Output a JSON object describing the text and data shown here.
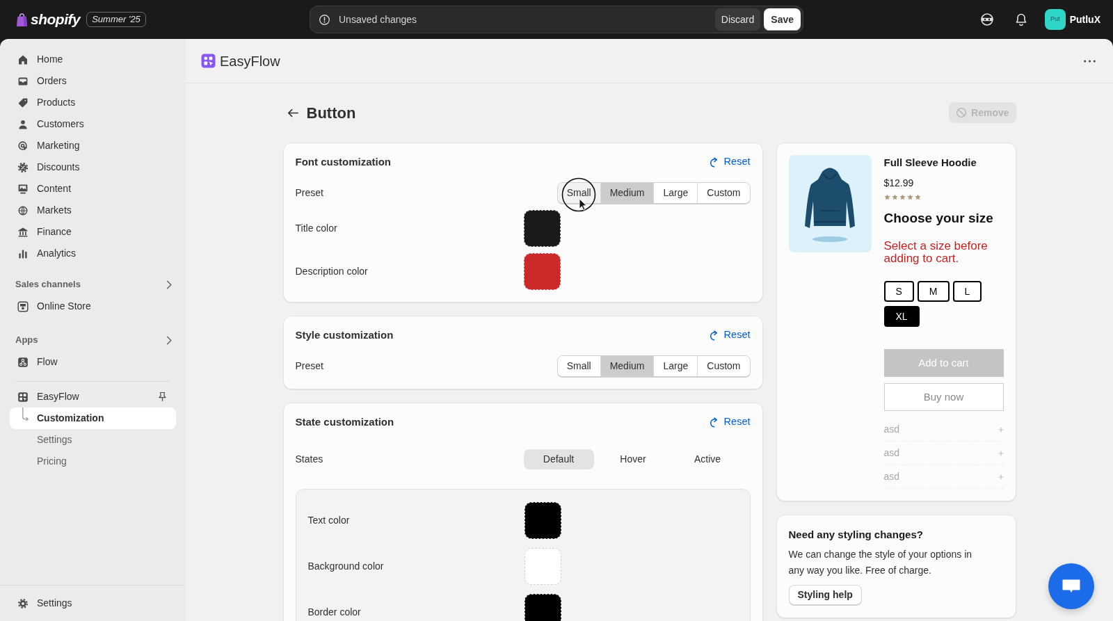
{
  "top_bar": {
    "logo": "shopify",
    "badge": "Summer '25",
    "save_bar": {
      "message": "Unsaved changes",
      "buttons": [
        {
          "label": "Discard",
          "kind": "secondary"
        },
        {
          "label": "Save",
          "kind": "primary"
        }
      ]
    },
    "account": {
      "initials": "Put",
      "name": "PutluX"
    }
  },
  "sidebar": {
    "items": [
      {
        "label": "Home",
        "selected": false
      },
      {
        "label": "Orders",
        "selected": false
      },
      {
        "label": "Products",
        "selected": false
      },
      {
        "label": "Customers",
        "selected": false
      },
      {
        "label": "Marketing",
        "selected": false
      },
      {
        "label": "Discounts",
        "selected": false
      },
      {
        "label": "Content",
        "selected": false
      },
      {
        "label": "Markets",
        "selected": false
      },
      {
        "label": "Finance",
        "selected": false
      },
      {
        "label": "Analytics",
        "selected": false
      }
    ],
    "sections": [
      {
        "title": "Sales channels",
        "items": [
          {
            "label": "Online Store",
            "selected": false
          }
        ]
      },
      {
        "title": "Apps",
        "items": [
          {
            "label": "Flow",
            "selected": false
          }
        ]
      }
    ],
    "app": {
      "label": "EasyFlow",
      "children": [
        {
          "label": "Customization",
          "selected": true
        },
        {
          "label": "Settings",
          "selected": false
        },
        {
          "label": "Pricing",
          "selected": false
        }
      ]
    },
    "footer": {
      "label": "Settings"
    }
  },
  "app_header": {
    "title": "EasyFlow"
  },
  "page": {
    "title": "Button",
    "actions": [
      {
        "label": "Remove",
        "disabled": true
      }
    ]
  },
  "sections": [
    {
      "kind": "font",
      "title": "Font customization",
      "reset": "Reset",
      "preset": {
        "label": "Preset",
        "options": [
          {
            "label": "Small",
            "selected": false,
            "hovered": true
          },
          {
            "label": "Medium",
            "selected": true,
            "hovered": false
          },
          {
            "label": "Large",
            "selected": false,
            "hovered": false
          },
          {
            "label": "Custom",
            "selected": false,
            "hovered": false
          }
        ]
      },
      "colors": [
        {
          "label": "Title color",
          "color": "#1a1a1a"
        },
        {
          "label": "Description color",
          "color": "#cc2a2a"
        }
      ]
    },
    {
      "kind": "style",
      "title": "Style customization",
      "reset": "Reset",
      "preset": {
        "label": "Preset",
        "options": [
          {
            "label": "Small",
            "selected": false,
            "hovered": false
          },
          {
            "label": "Medium",
            "selected": true,
            "hovered": false
          },
          {
            "label": "Large",
            "selected": false,
            "hovered": false
          },
          {
            "label": "Custom",
            "selected": false,
            "hovered": false
          }
        ]
      }
    },
    {
      "kind": "state",
      "title": "State customization",
      "reset": "Reset",
      "states": {
        "label": "States",
        "tabs": [
          {
            "label": "Default",
            "selected": true
          },
          {
            "label": "Hover",
            "selected": false
          },
          {
            "label": "Active",
            "selected": false
          }
        ]
      },
      "colors": [
        {
          "label": "Text color",
          "color": "#000000"
        },
        {
          "label": "Background color",
          "color": "#ffffff"
        },
        {
          "label": "Border color",
          "color": "#000000"
        }
      ]
    }
  ],
  "preview": {
    "title": "Full Sleeve Hoodie",
    "price": "$12.99",
    "stars": 5,
    "heading": "Choose your size",
    "error": "Select a size before adding to cart.",
    "sizes": [
      {
        "label": "S",
        "selected": false
      },
      {
        "label": "M",
        "selected": false
      },
      {
        "label": "L",
        "selected": false
      },
      {
        "label": "XL",
        "selected": true
      }
    ],
    "buttons": [
      {
        "label": "Add to cart",
        "kind": "primary",
        "disabled": true
      },
      {
        "label": "Buy now",
        "kind": "secondary",
        "disabled": true
      }
    ],
    "accordion": [
      {
        "label": "asd"
      },
      {
        "label": "asd"
      },
      {
        "label": "asd"
      }
    ]
  },
  "help": {
    "title": "Need any styling changes?",
    "text": "We can change the style of your options in any way you like. Free of charge.",
    "button": "Styling help"
  }
}
